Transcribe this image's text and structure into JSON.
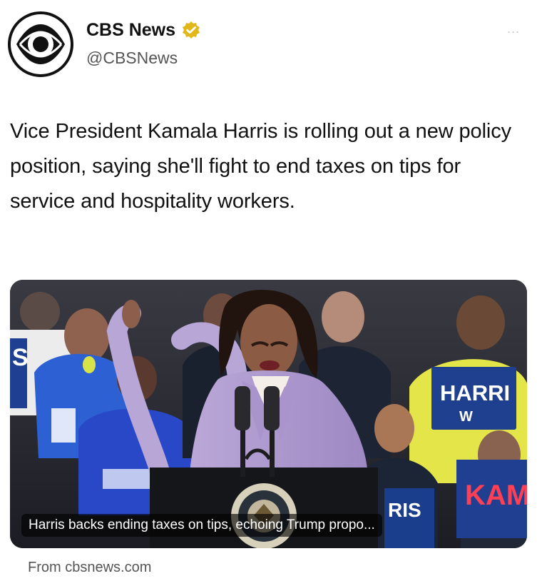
{
  "tweet": {
    "author": {
      "name": "CBS News",
      "handle": "@CBSNews",
      "verified": true,
      "verified_badge_color": "#e2b719",
      "avatar_icon": "cbs-eye-logo"
    },
    "menu_icon": "more-options-icon",
    "menu_label": "...",
    "text": "Vice President Kamala Harris is rolling out a new policy position, saying she'll fight to end taxes on tips for service and hospitality workers.",
    "card": {
      "image_description_icon": "news-photo",
      "caption": "Harris backs ending taxes on tips, echoing Trump propo...",
      "sign_text_1": "HARRI",
      "sign_text_2": "KAMA",
      "sign_text_3": "RIS",
      "source": "From cbsnews.com"
    }
  },
  "colors": {
    "background": "#ffffff",
    "text": "#111111",
    "secondary_text": "#555555",
    "blazer": "#b9a7d6",
    "sign_blue": "#1f3f8f",
    "jacket_yellow": "#e7e84a"
  }
}
